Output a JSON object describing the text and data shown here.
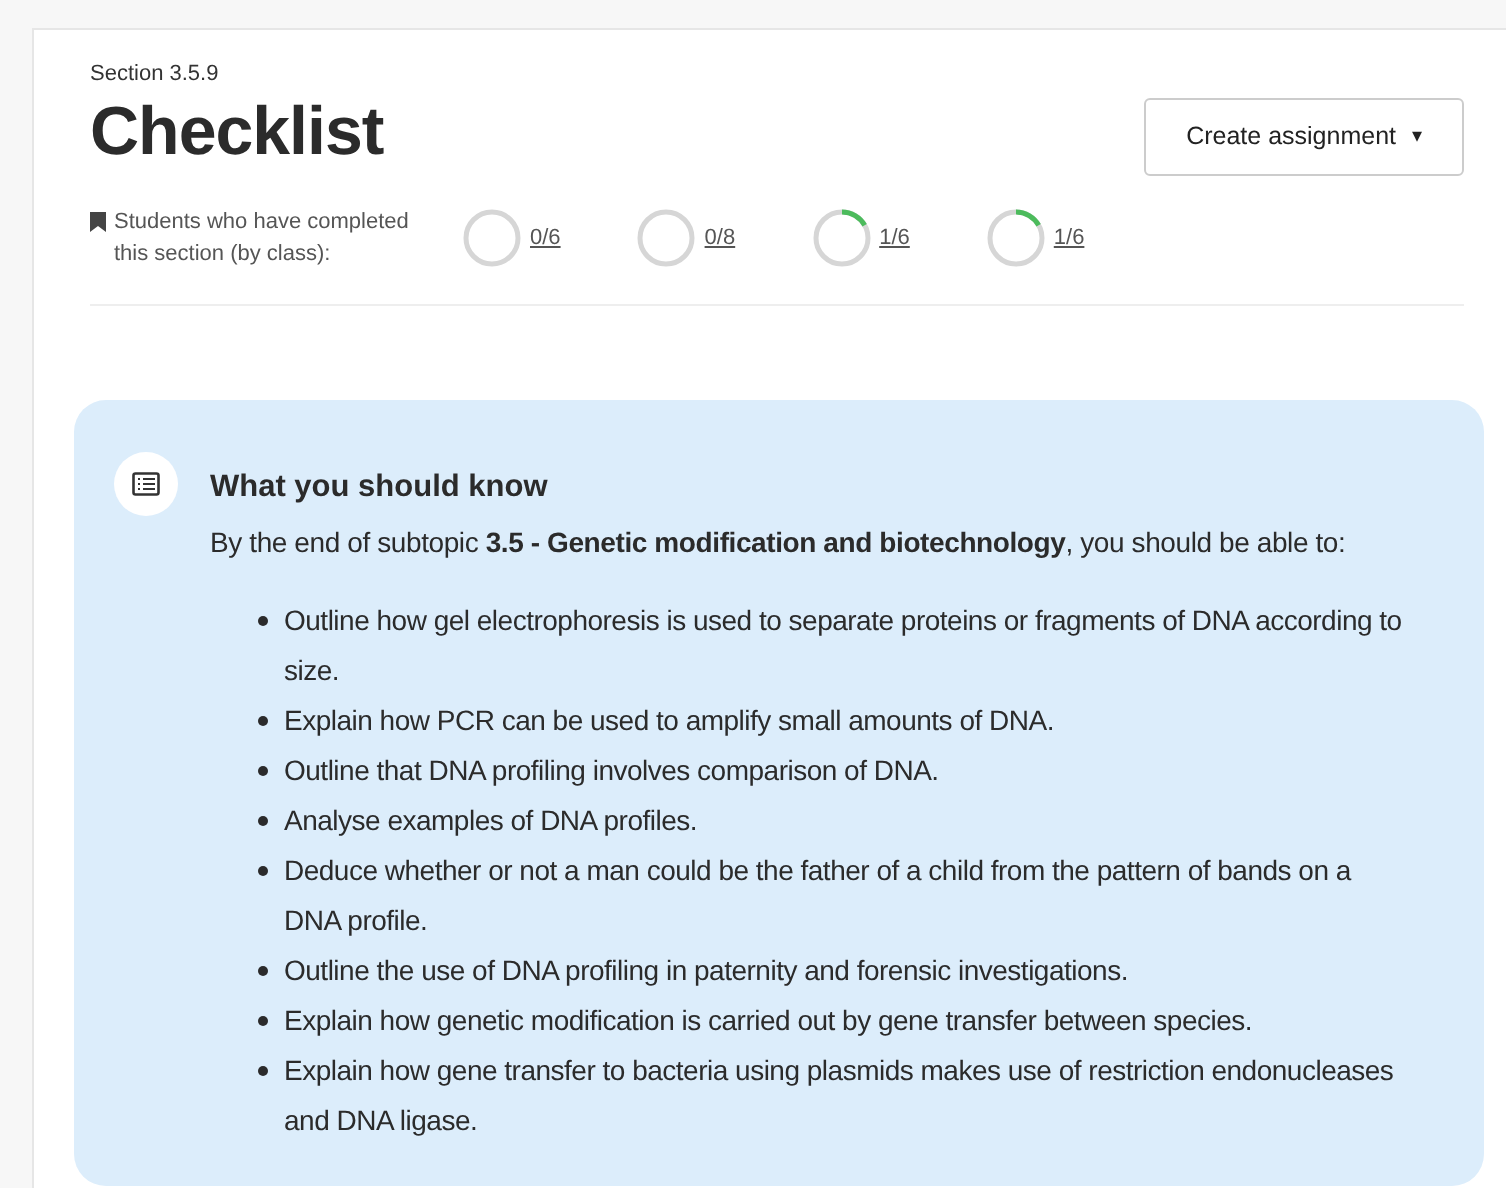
{
  "section_label": "Section 3.5.9",
  "title": "Checklist",
  "create_button": {
    "label": "Create assignment",
    "caret": "▾"
  },
  "completion": {
    "label": "Students who have completed this section (by class):",
    "classes": [
      {
        "reading": "0/6"
      },
      {
        "reading": "0/8"
      },
      {
        "reading": "1/6"
      },
      {
        "reading": "1/6"
      }
    ]
  },
  "callout": {
    "heading": "What you should know",
    "intro": "By the end of subtopic **3.5 - Genetic modification and biotechnology**, you should be able to:",
    "items": [
      "Outline how gel electrophoresis is used to separate proteins or fragments of DNA according to size.",
      "Explain how PCR can be used to amplify small amounts of DNA.",
      "Outline that DNA profiling involves comparison of DNA.",
      "Analyse examples of DNA profiles.",
      "Deduce whether or not a man could be the father of a child from the pattern of bands on a DNA profile.",
      "Outline the use of DNA profiling in paternity and forensic investigations.",
      "Explain how genetic modification is carried out by gene transfer between species.",
      "Explain how gene transfer to bacteria using plasmids makes use of restriction endonucleases and DNA ligase."
    ]
  }
}
